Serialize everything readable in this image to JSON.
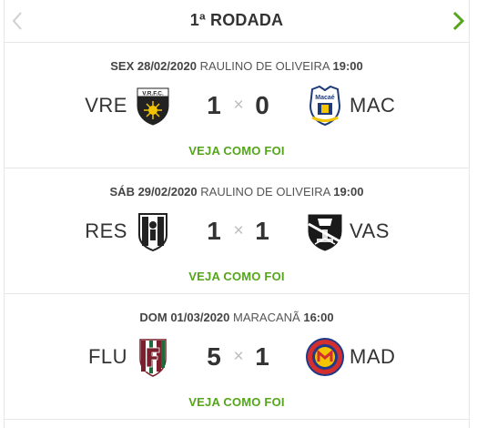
{
  "round": {
    "title": "1ª RODADA"
  },
  "matches": [
    {
      "day": "SEX 28/02/2020",
      "stadium": "RAULINO DE OLIVEIRA",
      "time": "19:00",
      "home": {
        "abbr": "VRE",
        "crest_text": "V.R.F.C.",
        "crest_icon": "volta-redonda-crest-icon"
      },
      "away": {
        "abbr": "MAC",
        "crest_text": "Macaé",
        "crest_icon": "macae-crest-icon"
      },
      "home_score": "1",
      "away_score": "0",
      "separator": "×",
      "link": "VEJA COMO FOI"
    },
    {
      "day": "SÁB 29/02/2020",
      "stadium": "RAULINO DE OLIVEIRA",
      "time": "19:00",
      "home": {
        "abbr": "RES",
        "crest_icon": "resende-crest-icon"
      },
      "away": {
        "abbr": "VAS",
        "crest_icon": "vasco-crest-icon"
      },
      "home_score": "1",
      "away_score": "1",
      "separator": "×",
      "link": "VEJA COMO FOI"
    },
    {
      "day": "DOM 01/03/2020",
      "stadium": "MARACANÃ",
      "time": "16:00",
      "home": {
        "abbr": "FLU",
        "crest_icon": "fluminense-crest-icon"
      },
      "away": {
        "abbr": "MAD",
        "crest_icon": "madureira-crest-icon"
      },
      "home_score": "5",
      "away_score": "1",
      "separator": "×",
      "link": "VEJA COMO FOI"
    }
  ],
  "colors": {
    "link_green": "#55a51c",
    "divider": "#e6e6e6",
    "separator": "#bbbbbb"
  }
}
